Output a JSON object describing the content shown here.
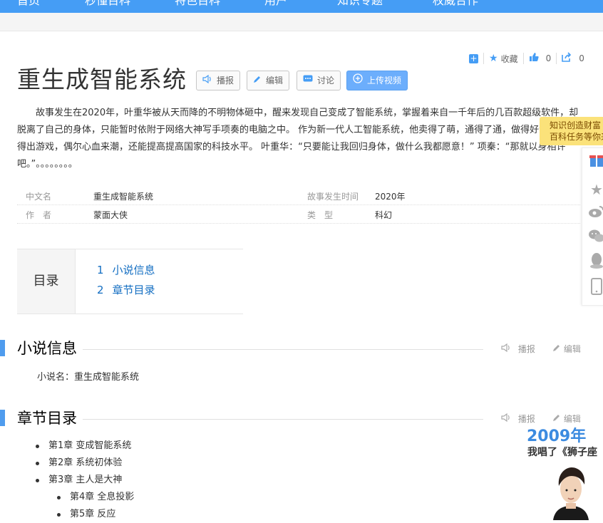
{
  "topnav": {
    "items": [
      "首页",
      "秒懂百科",
      "特色百科",
      "用户",
      "知识专题",
      "权威合作"
    ]
  },
  "toolbar": {
    "collect_label": "收藏",
    "like_count": "0",
    "share_count": "0"
  },
  "title": "重生成智能系统",
  "buttons": {
    "broadcast": "播报",
    "edit": "编辑",
    "discuss": "讨论",
    "upload_video": "上传视频"
  },
  "summary": "故事发生在2020年，叶重华被从天而降的不明物体砸中，醒来发现自己变成了智能系统，掌握着来自一千年后的几百款超级软件，却脱离了自己的身体，只能暂时依附于网络大神写手项奏的电脑之中。 作为新一代人工智能系统，他卖得了萌，通得了通，做得好动画，开发得出游戏，偶尔心血来潮，还能提高提高国家的科技水平。 叶重华：“只要能让我回归身体，做什么我都愿意！” 项秦：“那就以身相许吧。”。。。。。。。。",
  "info": {
    "name_key": "中文名",
    "name_val": "重生成智能系统",
    "time_key": "故事发生时间",
    "time_val": "2020年",
    "author_key": "作　者",
    "author_val": "蒙面大侠",
    "type_key": "类　型",
    "type_val": "科幻"
  },
  "catalog": {
    "label": "目录",
    "items": [
      {
        "num": "1",
        "text": "小说信息"
      },
      {
        "num": "2",
        "text": "章节目录"
      }
    ]
  },
  "sections": {
    "s1_title": "小说信息",
    "s1_text": "小说名：重生成智能系统",
    "s2_title": "章节目录",
    "broadcast": "播报",
    "edit": "编辑"
  },
  "chapters": [
    "第1章 变成智能系统",
    "第2章 系统初体验",
    "第3章 主人是大神",
    "第4章 全息投影",
    "第5章 反应"
  ],
  "tooltip": {
    "line1": "知识创造财富",
    "line2": "百科任务等你来"
  },
  "promo": {
    "year": "2009年",
    "text": "我唱了《狮子座"
  },
  "colors": {
    "nav": "#459df5",
    "accent": "#4f9cee",
    "link": "#136ec2"
  }
}
